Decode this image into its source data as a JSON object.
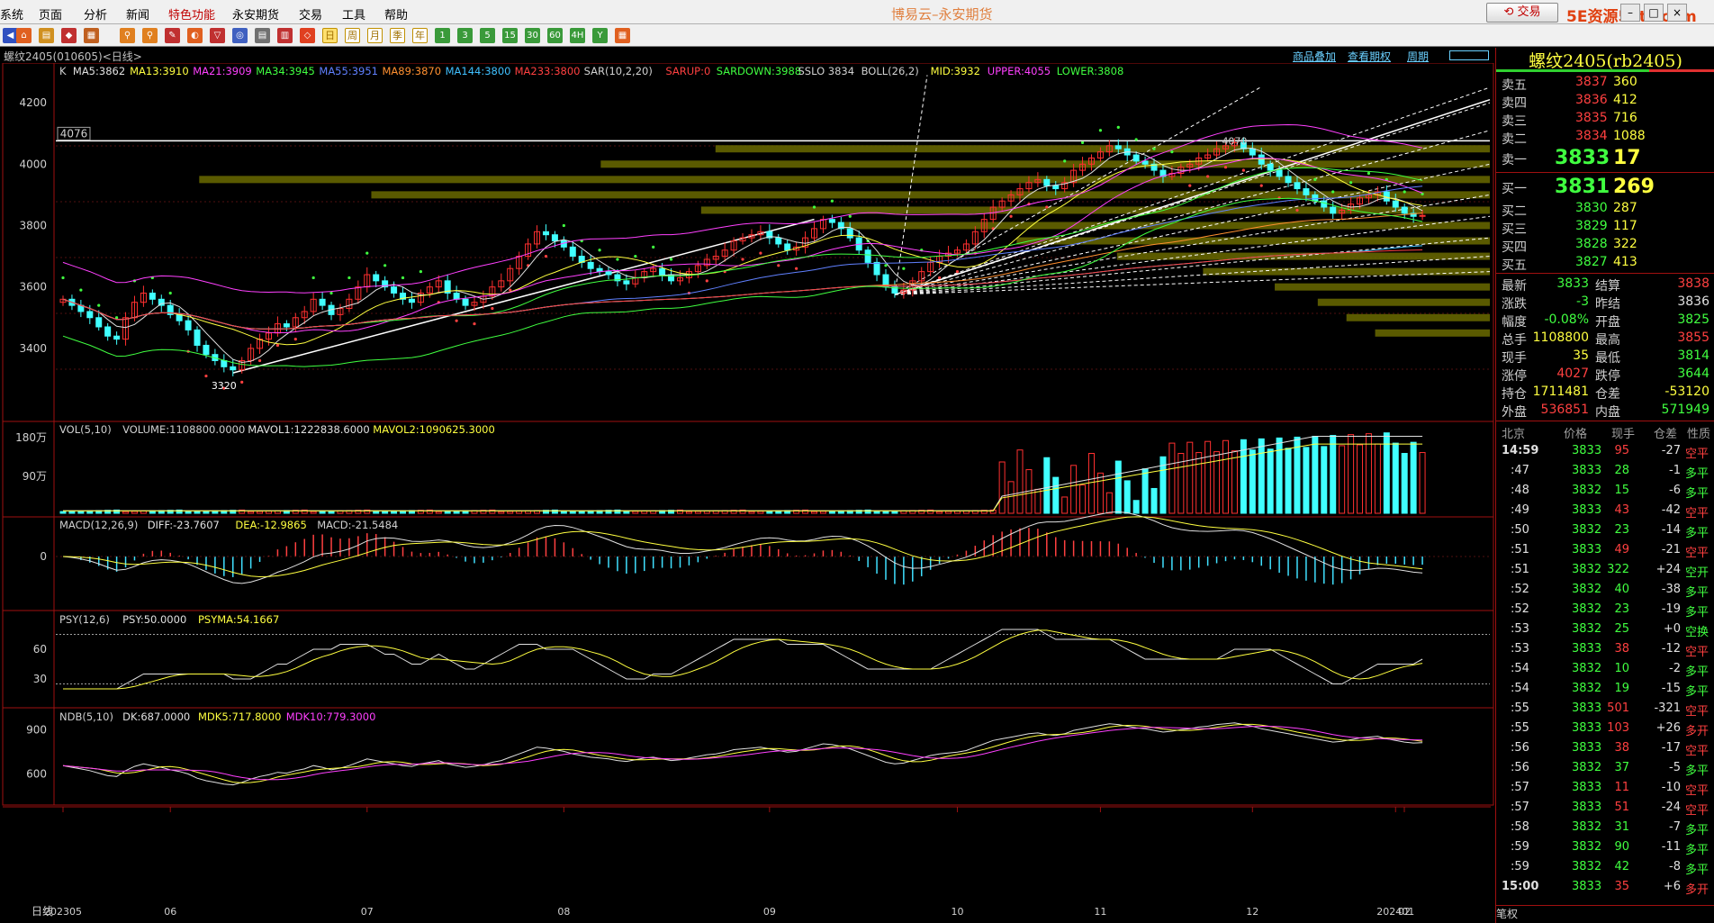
{
  "menubar": {
    "items": [
      "系统",
      "页面",
      "分析",
      "新闻",
      "特色功能",
      "永安期货",
      "交易",
      "工具",
      "帮助"
    ],
    "highlight_index": 4,
    "app_title": "博易云–永安期货",
    "trade_label": "交易",
    "watermark": "5E资源5etz.com"
  },
  "toolbar": {
    "periods": [
      "日",
      "周",
      "月",
      "季",
      "年"
    ],
    "active_period": "日",
    "minutes": [
      "1",
      "3",
      "5",
      "15",
      "30",
      "60",
      "4H"
    ]
  },
  "chart_header": {
    "title": "螺纹2405(010605)<日线>",
    "links": [
      "商品叠加",
      "查看期权",
      "周期"
    ]
  },
  "main_indicators": [
    {
      "text": "K",
      "color": "#d0d0d0"
    },
    {
      "text": "MA5:3862",
      "color": "#e0e0e0"
    },
    {
      "text": "MA13:3910",
      "color": "#ffff40"
    },
    {
      "text": "MA21:3909",
      "color": "#ff40ff"
    },
    {
      "text": "MA34:3945",
      "color": "#40ff40"
    },
    {
      "text": "MA55:3951",
      "color": "#6080ff"
    },
    {
      "text": "MA89:3870",
      "color": "#ff9030"
    },
    {
      "text": "MA144:3800",
      "color": "#40c0ff"
    },
    {
      "text": "MA233:3800",
      "color": "#ff4040"
    },
    {
      "text": "SAR(10,2,20)",
      "color": "#d0d0d0"
    },
    {
      "text": "SARUP:0",
      "color": "#ff4040"
    },
    {
      "text": "SARDOWN:3988",
      "color": "#40ff40"
    },
    {
      "text": "SSLO 3834",
      "color": "#d0d0d0"
    },
    {
      "text": "BOLL(26,2)",
      "color": "#d0d0d0"
    },
    {
      "text": "MID:3932",
      "color": "#ffff40"
    },
    {
      "text": "UPPER:4055",
      "color": "#ff40ff"
    },
    {
      "text": "LOWER:3808",
      "color": "#40ff40"
    }
  ],
  "price_axis": [
    "4200",
    "4000",
    "3800",
    "3600",
    "3400"
  ],
  "price_annotations": {
    "high_box": "4076",
    "high_label": "4070",
    "low_label": "3320"
  },
  "vol_indicators": [
    {
      "text": "VOL(5,10)",
      "color": "#d0d0d0"
    },
    {
      "text": "VOLUME:1108800.0000",
      "color": "#d0d0d0"
    },
    {
      "text": "MAVOL1:1222838.6000",
      "color": "#e0e0e0"
    },
    {
      "text": "MAVOL2:1090625.3000",
      "color": "#ffff40"
    }
  ],
  "vol_axis": [
    "180万",
    "90万"
  ],
  "macd_indicators": [
    {
      "text": "MACD(12,26,9)",
      "color": "#d0d0d0"
    },
    {
      "text": "DIFF:-23.7607",
      "color": "#e0e0e0"
    },
    {
      "text": "DEA:-12.9865",
      "color": "#ffff40"
    },
    {
      "text": "MACD:-21.5484",
      "color": "#d0d0d0"
    }
  ],
  "macd_axis": [
    "0"
  ],
  "psy_indicators": [
    {
      "text": "PSY(12,6)",
      "color": "#d0d0d0"
    },
    {
      "text": "PSY:50.0000",
      "color": "#e0e0e0"
    },
    {
      "text": "PSYMA:54.1667",
      "color": "#ffff40"
    }
  ],
  "psy_axis": [
    "60",
    "30"
  ],
  "ndb_indicators": [
    {
      "text": "NDB(5,10)",
      "color": "#d0d0d0"
    },
    {
      "text": "DK:687.0000",
      "color": "#e0e0e0"
    },
    {
      "text": "MDK5:717.8000",
      "color": "#ffff40"
    },
    {
      "text": "MDK10:779.3000",
      "color": "#ff40ff"
    }
  ],
  "ndb_axis": [
    "900",
    "600"
  ],
  "x_axis": {
    "period_label": "日线",
    "ticks": [
      "202305",
      "06",
      "07",
      "08",
      "09",
      "10",
      "11",
      "12",
      "202401",
      "02"
    ]
  },
  "quote": {
    "title": "螺纹2405(rb2405)",
    "asks": [
      {
        "label": "卖五",
        "price": "3837",
        "vol": "360"
      },
      {
        "label": "卖四",
        "price": "3836",
        "vol": "412"
      },
      {
        "label": "卖三",
        "price": "3835",
        "vol": "716"
      },
      {
        "label": "卖二",
        "price": "3834",
        "vol": "1088"
      },
      {
        "label": "卖一",
        "price": "3833",
        "vol": "17"
      }
    ],
    "bids": [
      {
        "label": "买一",
        "price": "3831",
        "vol": "269"
      },
      {
        "label": "买二",
        "price": "3830",
        "vol": "287"
      },
      {
        "label": "买三",
        "price": "3829",
        "vol": "117"
      },
      {
        "label": "买四",
        "price": "3828",
        "vol": "322"
      },
      {
        "label": "买五",
        "price": "3827",
        "vol": "413"
      }
    ],
    "stats": [
      {
        "l1": "最新",
        "v1": "3833",
        "c1": "green",
        "l2": "结算",
        "v2": "3838",
        "c2": "red"
      },
      {
        "l1": "涨跌",
        "v1": "-3",
        "c1": "green",
        "l2": "昨结",
        "v2": "3836",
        "c2": "white"
      },
      {
        "l1": "幅度",
        "v1": "-0.08%",
        "c1": "green",
        "l2": "开盘",
        "v2": "3825",
        "c2": "green"
      },
      {
        "l1": "总手",
        "v1": "1108800",
        "c1": "yellow",
        "l2": "最高",
        "v2": "3855",
        "c2": "red"
      },
      {
        "l1": "现手",
        "v1": "35",
        "c1": "yellow",
        "l2": "最低",
        "v2": "3814",
        "c2": "green"
      },
      {
        "l1": "涨停",
        "v1": "4027",
        "c1": "red",
        "l2": "跌停",
        "v2": "3644",
        "c2": "green"
      },
      {
        "l1": "持仓",
        "v1": "1711481",
        "c1": "yellow",
        "l2": "仓差",
        "v2": "-53120",
        "c2": "yellow"
      },
      {
        "l1": "外盘",
        "v1": "536851",
        "c1": "red",
        "l2": "内盘",
        "v2": "571949",
        "c2": "green"
      }
    ],
    "ticks_header": [
      "北京",
      "价格",
      "现手",
      "仓差",
      "性质"
    ],
    "ticks": [
      {
        "t": "14:59",
        "p": "3833",
        "v": "95",
        "vc": "red",
        "d": "-27",
        "n": "空平",
        "nc": "red"
      },
      {
        "t": ":47",
        "p": "3833",
        "v": "28",
        "vc": "green",
        "d": "-1",
        "n": "多平",
        "nc": "green"
      },
      {
        "t": ":48",
        "p": "3832",
        "v": "15",
        "vc": "green",
        "d": "-6",
        "n": "多平",
        "nc": "green"
      },
      {
        "t": ":49",
        "p": "3833",
        "v": "43",
        "vc": "red",
        "d": "-42",
        "n": "空平",
        "nc": "red"
      },
      {
        "t": ":50",
        "p": "3832",
        "v": "23",
        "vc": "green",
        "d": "-14",
        "n": "多平",
        "nc": "green"
      },
      {
        "t": ":51",
        "p": "3833",
        "v": "49",
        "vc": "red",
        "d": "-21",
        "n": "空平",
        "nc": "red"
      },
      {
        "t": ":51",
        "p": "3832",
        "v": "322",
        "vc": "green",
        "d": "+24",
        "n": "空开",
        "nc": "green"
      },
      {
        "t": ":52",
        "p": "3832",
        "v": "40",
        "vc": "green",
        "d": "-38",
        "n": "多平",
        "nc": "green"
      },
      {
        "t": ":52",
        "p": "3832",
        "v": "23",
        "vc": "green",
        "d": "-19",
        "n": "多平",
        "nc": "green"
      },
      {
        "t": ":53",
        "p": "3832",
        "v": "25",
        "vc": "green",
        "d": "+0",
        "n": "空换",
        "nc": "green"
      },
      {
        "t": ":53",
        "p": "3833",
        "v": "38",
        "vc": "red",
        "d": "-12",
        "n": "空平",
        "nc": "red"
      },
      {
        "t": ":54",
        "p": "3832",
        "v": "10",
        "vc": "green",
        "d": "-2",
        "n": "多平",
        "nc": "green"
      },
      {
        "t": ":54",
        "p": "3832",
        "v": "19",
        "vc": "green",
        "d": "-15",
        "n": "多平",
        "nc": "green"
      },
      {
        "t": ":55",
        "p": "3833",
        "v": "501",
        "vc": "red",
        "d": "-321",
        "n": "空平",
        "nc": "red"
      },
      {
        "t": ":55",
        "p": "3833",
        "v": "103",
        "vc": "red",
        "d": "+26",
        "n": "多开",
        "nc": "red"
      },
      {
        "t": ":56",
        "p": "3833",
        "v": "38",
        "vc": "red",
        "d": "-17",
        "n": "空平",
        "nc": "red"
      },
      {
        "t": ":56",
        "p": "3832",
        "v": "37",
        "vc": "green",
        "d": "-5",
        "n": "多平",
        "nc": "green"
      },
      {
        "t": ":57",
        "p": "3833",
        "v": "11",
        "vc": "red",
        "d": "-10",
        "n": "空平",
        "nc": "red"
      },
      {
        "t": ":57",
        "p": "3833",
        "v": "51",
        "vc": "red",
        "d": "-24",
        "n": "空平",
        "nc": "red"
      },
      {
        "t": ":58",
        "p": "3832",
        "v": "31",
        "vc": "green",
        "d": "-7",
        "n": "多平",
        "nc": "green"
      },
      {
        "t": ":59",
        "p": "3832",
        "v": "90",
        "vc": "green",
        "d": "-11",
        "n": "多平",
        "nc": "green"
      },
      {
        "t": ":59",
        "p": "3832",
        "v": "42",
        "vc": "green",
        "d": "-8",
        "n": "多平",
        "nc": "green"
      },
      {
        "t": "15:00",
        "p": "3833",
        "v": "35",
        "vc": "red",
        "d": "+6",
        "n": "多开",
        "nc": "red"
      }
    ],
    "tabs": [
      "笔",
      "权"
    ]
  },
  "chart_data": {
    "type": "candlestick",
    "title": "螺纹2405(010605)<日线>",
    "y_range": [
      3250,
      4300
    ],
    "closes": [
      3560,
      3540,
      3520,
      3500,
      3470,
      3440,
      3430,
      3500,
      3550,
      3580,
      3560,
      3540,
      3510,
      3490,
      3460,
      3410,
      3380,
      3360,
      3340,
      3330,
      3360,
      3400,
      3430,
      3450,
      3480,
      3470,
      3500,
      3520,
      3560,
      3540,
      3510,
      3530,
      3560,
      3600,
      3640,
      3620,
      3600,
      3580,
      3560,
      3550,
      3580,
      3600,
      3620,
      3580,
      3560,
      3540,
      3550,
      3570,
      3600,
      3620,
      3660,
      3700,
      3740,
      3780,
      3770,
      3750,
      3730,
      3700,
      3680,
      3660,
      3650,
      3640,
      3620,
      3610,
      3630,
      3650,
      3660,
      3640,
      3620,
      3630,
      3650,
      3670,
      3690,
      3700,
      3720,
      3750,
      3760,
      3770,
      3780,
      3760,
      3740,
      3720,
      3730,
      3760,
      3790,
      3820,
      3810,
      3790,
      3760,
      3720,
      3680,
      3640,
      3600,
      3580,
      3590,
      3620,
      3650,
      3680,
      3700,
      3710,
      3720,
      3740,
      3780,
      3820,
      3860,
      3880,
      3900,
      3920,
      3940,
      3950,
      3930,
      3920,
      3940,
      3980,
      4000,
      4020,
      4040,
      4060,
      4050,
      4030,
      4010,
      4000,
      3980,
      3960,
      3970,
      3990,
      4000,
      4020,
      4030,
      4050,
      4060,
      4070,
      4050,
      4030,
      4000,
      3980,
      3960,
      3940,
      3920,
      3900,
      3880,
      3860,
      3840,
      3850,
      3870,
      3890,
      3900,
      3910,
      3880,
      3860,
      3840,
      3830,
      3833
    ],
    "volume_mavol": {
      "MAVOL1": 1222838.6,
      "MAVOL2": 1090625.3,
      "VOLUME": 1108800
    }
  }
}
